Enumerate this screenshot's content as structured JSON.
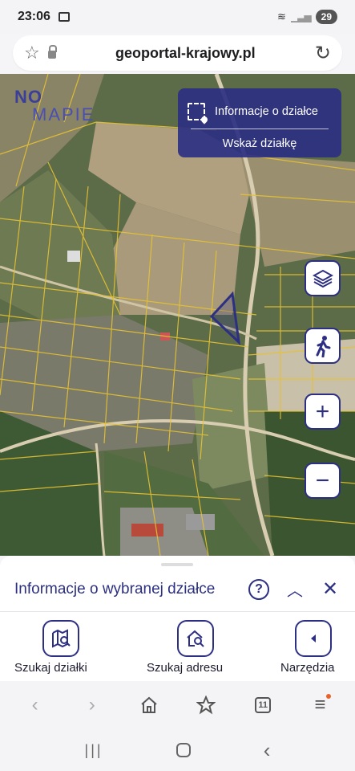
{
  "status": {
    "time": "23:06",
    "battery": "29"
  },
  "browser": {
    "url": "geoportal-krajowy.pl"
  },
  "map": {
    "logo_part1": "NO",
    "logo_part2": "MAPIE",
    "info_panel": {
      "title": "Informacje o działce",
      "show_button": "Wskaż działkę"
    },
    "controls": {
      "zoom_in": "+",
      "zoom_out": "−"
    }
  },
  "sheet": {
    "title": "Informacje o wybranej działce",
    "help": "?",
    "tools": [
      {
        "label": "Szukaj działki"
      },
      {
        "label": "Szukaj adresu"
      },
      {
        "label": "Narzędzia"
      }
    ]
  },
  "nav": {
    "tabs_count": "11"
  },
  "colors": {
    "accent": "#2d3082",
    "panel": "#2d3082",
    "parcel_lines": "#e6c232"
  },
  "icons": [
    "star-icon",
    "lock-icon",
    "reload-icon",
    "select-area-icon",
    "layers-icon",
    "walk-icon",
    "plus-icon",
    "minus-icon",
    "help-icon",
    "chevron-up-icon",
    "close-icon",
    "map-search-icon",
    "home-search-icon",
    "triangle-left-icon",
    "back-icon",
    "forward-icon",
    "home-icon",
    "bookmark-star-icon",
    "tabs-icon",
    "menu-icon"
  ]
}
